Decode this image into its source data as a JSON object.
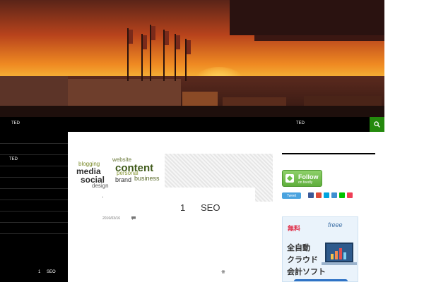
{
  "nav": {
    "site_title": "TED",
    "menu_item": "TED",
    "search_icon": "search-icon"
  },
  "sidebar": {
    "menu_item": "TED",
    "footer_num": "1",
    "footer_label": "SEO"
  },
  "post": {
    "title_num": "1",
    "title_text": "SEO",
    "date": "2016/03/16",
    "comment_icon": "comment-icon",
    "wordcloud_words": [
      "blogging",
      "website",
      "content",
      "media",
      "social",
      "personal",
      "brand",
      "business",
      "design"
    ],
    "footer_glyph": "※"
  },
  "right_sidebar": {
    "feedly_label": "Follow",
    "feedly_sub": "on feedly",
    "tweet_label": "Tweet",
    "ad": {
      "badge": "無料",
      "brand": "freee",
      "line1": "全自動",
      "line2": "クラウド",
      "line3": "会計ソフト"
    }
  },
  "colors": {
    "accent_green": "#24890d",
    "nav_bg": "#000000",
    "feedly_green": "#6bbf46",
    "twitter_blue": "#4aa3df"
  }
}
